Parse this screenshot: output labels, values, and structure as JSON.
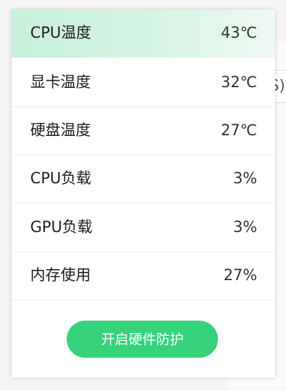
{
  "background": {
    "partial_text": "S)"
  },
  "hardware_popup": {
    "items": [
      {
        "label": "CPU温度",
        "value": "43℃"
      },
      {
        "label": "显卡温度",
        "value": "32℃"
      },
      {
        "label": "硬盘温度",
        "value": "27℃"
      },
      {
        "label": "CPU负载",
        "value": "3%"
      },
      {
        "label": "GPU负载",
        "value": "3%"
      },
      {
        "label": "内存使用",
        "value": "27%"
      }
    ],
    "button_label": "开启硬件防护",
    "colors": {
      "accent": "#37d27c",
      "highlight": "#c7f0da"
    }
  }
}
